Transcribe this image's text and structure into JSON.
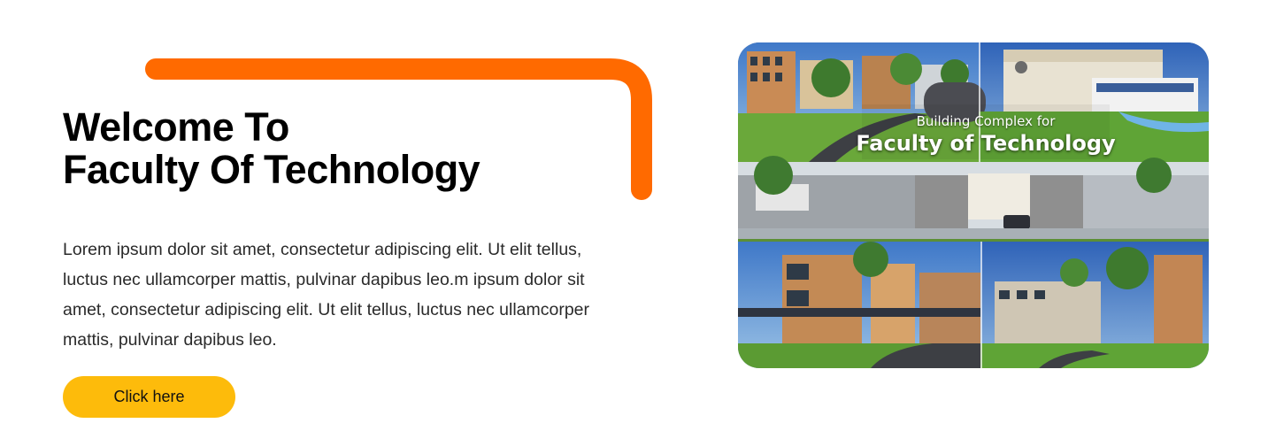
{
  "hero": {
    "title_line1": "Welcome To",
    "title_line2": "Faculty Of Technology",
    "body": "Lorem ipsum dolor sit amet, consectetur adipiscing elit. Ut elit tellus, luctus nec ullamcorper mattis, pulvinar dapibus leo.m ipsum dolor sit amet, consectetur adipiscing elit. Ut elit tellus, luctus nec ullamcorper mattis, pulvinar dapibus leo.",
    "cta_label": "Click here"
  },
  "image": {
    "caption_sub": "Building Complex for",
    "caption_main": "Faculty of Technology"
  },
  "colors": {
    "accent": "#ff6a00",
    "button": "#fdbb0b"
  }
}
